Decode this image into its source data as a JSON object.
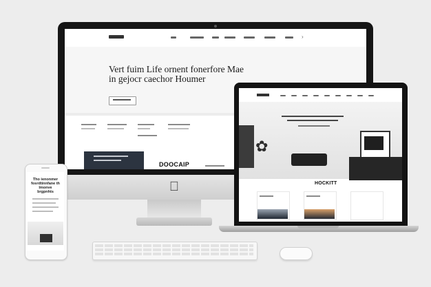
{
  "desktop": {
    "hero_title": "Vert fuim Life ornent fonerfore Mae in gejocr caechor Houmer",
    "brand_text": "DOOCAIP"
  },
  "laptop": {
    "brand_text": "HOCKITT"
  },
  "phone": {
    "title": "Tho ienonmer fosrdtinnfane th lmonve brgpnhts"
  },
  "colors": {
    "background": "#ededed",
    "device_frame": "#151515",
    "dark_card": "#2c3440"
  },
  "icons": {
    "desktop_logo": "apple-logo-icon"
  }
}
